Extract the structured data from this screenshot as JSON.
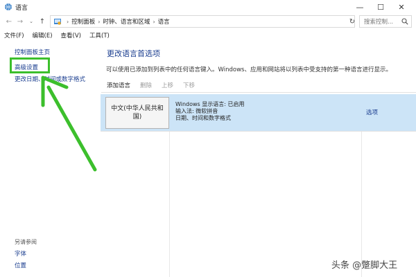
{
  "window": {
    "title": "语言",
    "controls": {
      "minimize": "—",
      "maximize": "☐",
      "close": "✕"
    }
  },
  "nav": {
    "back": "←",
    "forward": "→",
    "recent": "⌄",
    "up": "↑",
    "breadcrumb": [
      "控制面板",
      "时钟、语言和区域",
      "语言"
    ],
    "separator": "›",
    "refresh": "↻",
    "search_placeholder": "搜索控制..."
  },
  "menu": [
    "文件(F)",
    "编辑(E)",
    "查看(V)",
    "工具(T)"
  ],
  "sidebar": {
    "home": "控制面板主页",
    "advanced": "高级设置",
    "date": "更改日期、时间或数字格式",
    "see_also": "另请参阅",
    "font": "字体",
    "location": "位置"
  },
  "main": {
    "heading": "更改语言首选项",
    "description": "可以使用已添加到列表中的任何语言键入。Windows、应用和网站将以列表中受支持的第一种语言进行显示。",
    "toolbar": {
      "add": "添加语言",
      "remove": "删除",
      "up": "上移",
      "down": "下移"
    },
    "language": {
      "tile": "中文(中华人民共和国)",
      "info": [
        "Windows 显示语言: 已启用",
        "输入法: 微软拼音",
        "日期、时间和数字格式"
      ],
      "options": "选项"
    }
  },
  "annotation": {
    "highlight_color": "#3cbf2c"
  },
  "watermark": "头条 @蹩脚大王",
  "colors": {
    "link": "#1a3d8f",
    "selected_row": "#cce4f7",
    "green": "#3cbf2c"
  }
}
